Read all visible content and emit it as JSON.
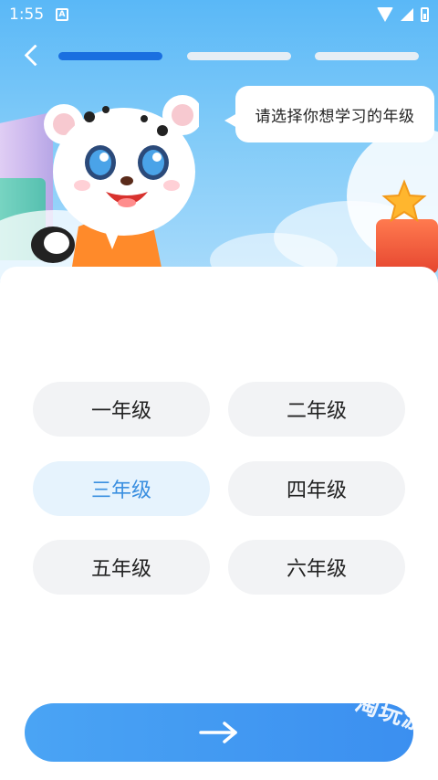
{
  "status_bar": {
    "time": "1:55",
    "notification_badge": "A"
  },
  "header": {
    "progress_steps": 3,
    "current_step": 1
  },
  "prompt": {
    "text": "请选择你想学习的年级"
  },
  "grades": [
    {
      "label": "一年级",
      "selected": false
    },
    {
      "label": "二年级",
      "selected": false
    },
    {
      "label": "三年级",
      "selected": true
    },
    {
      "label": "四年级",
      "selected": false
    },
    {
      "label": "五年级",
      "selected": false
    },
    {
      "label": "六年级",
      "selected": false
    }
  ],
  "colors": {
    "accent": "#3b8ff0",
    "selected_bg": "#e6f3fd",
    "selected_text": "#3a8fe0",
    "progress_active": "#1a6fe0"
  },
  "icons": {
    "back": "back-arrow-icon",
    "next": "right-arrow-icon"
  },
  "watermark": {
    "text": "淘玩游"
  }
}
